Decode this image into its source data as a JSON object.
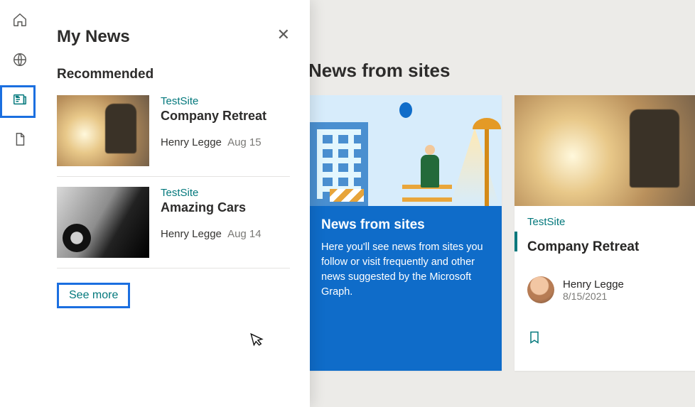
{
  "rail": {
    "items": [
      {
        "name": "home-icon"
      },
      {
        "name": "globe-icon"
      },
      {
        "name": "news-icon"
      },
      {
        "name": "file-icon"
      }
    ],
    "active_index": 2
  },
  "flyout": {
    "title": "My News",
    "close_label": "✕",
    "section": "Recommended",
    "items": [
      {
        "site": "TestSite",
        "title": "Company Retreat",
        "author": "Henry Legge",
        "date": "Aug 15",
        "thumb": "sunrise"
      },
      {
        "site": "TestSite",
        "title": "Amazing Cars",
        "author": "Henry Legge",
        "date": "Aug 14",
        "thumb": "car"
      }
    ],
    "see_more": "See more"
  },
  "main": {
    "heading": "News from sites",
    "tile_blue": {
      "title": "News from sites",
      "text": "Here you'll see news from sites you follow or visit frequently and other news suggested by the Microsoft Graph."
    },
    "tile_news": {
      "site": "TestSite",
      "title": "Company Retreat",
      "author": "Henry Legge",
      "date": "8/15/2021"
    }
  }
}
